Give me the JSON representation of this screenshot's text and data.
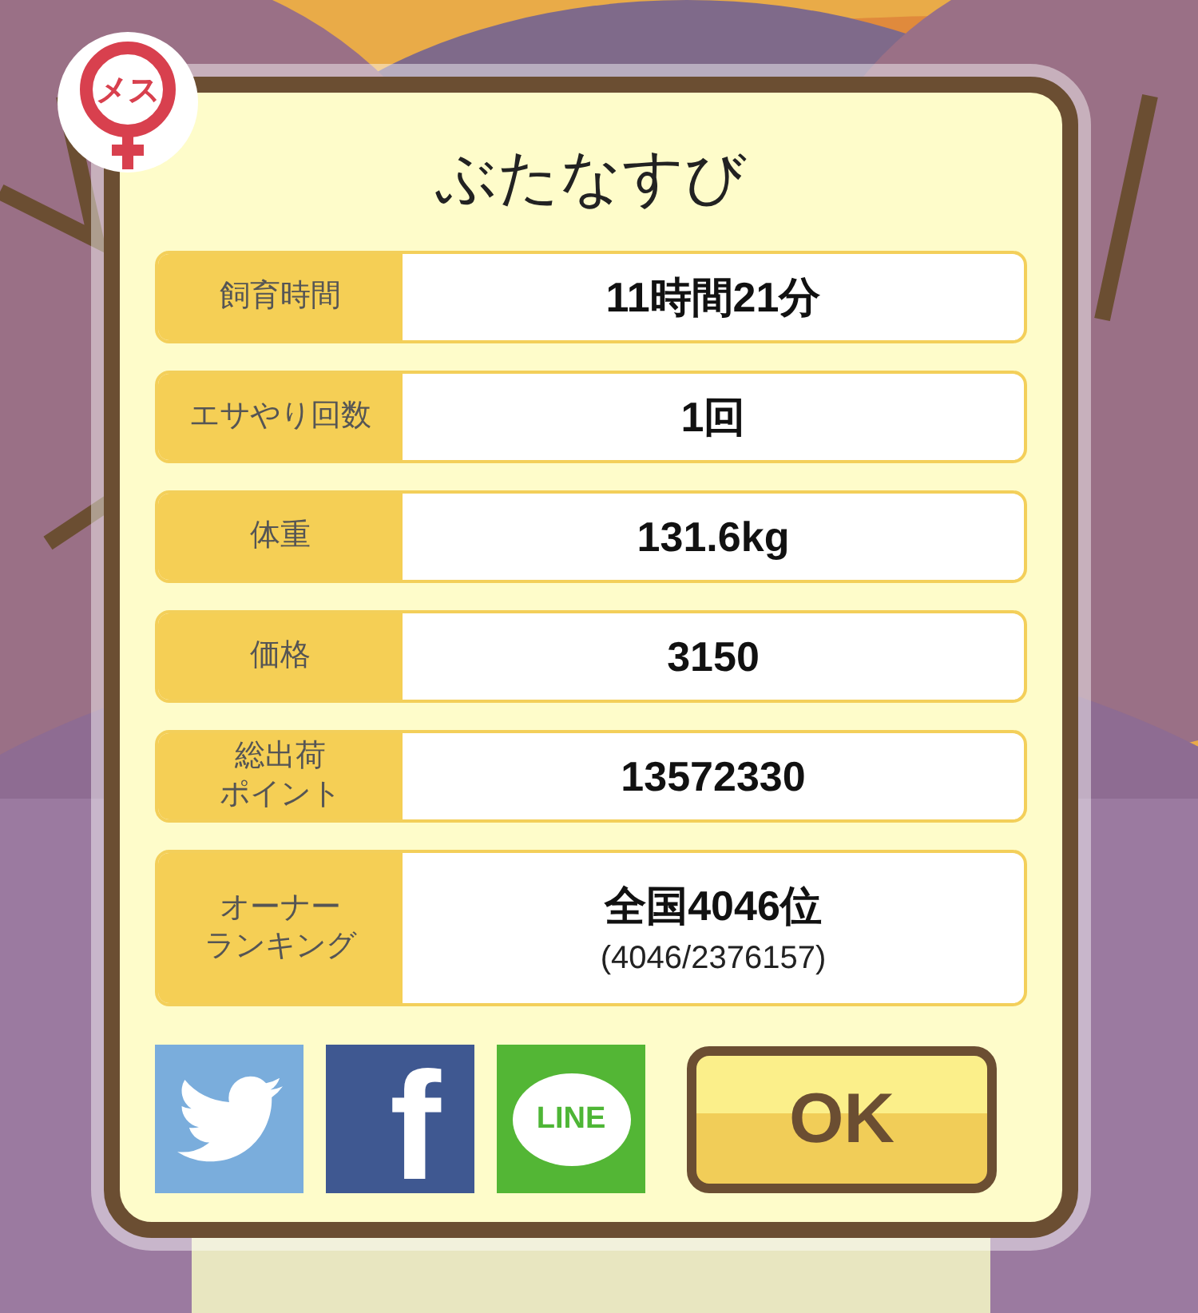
{
  "badge": {
    "text": "メス"
  },
  "title": "ぶたなすび",
  "stats": [
    {
      "label": "飼育時間",
      "value": "11時間21分"
    },
    {
      "label": "エサやり回数",
      "value": "1回"
    },
    {
      "label": "体重",
      "value": "131.6kg"
    },
    {
      "label": "価格",
      "value": "3150"
    },
    {
      "label": [
        "総出荷",
        "ポイント"
      ],
      "value": "13572330"
    },
    {
      "label": [
        "オーナー",
        "ランキング"
      ],
      "value": "全国4046位",
      "note": "(4046/2376157)"
    }
  ],
  "share": [
    {
      "kind": "twitter"
    },
    {
      "kind": "facebook",
      "text": "f"
    },
    {
      "kind": "line",
      "text": "LINE"
    }
  ],
  "ok_button": "OK"
}
